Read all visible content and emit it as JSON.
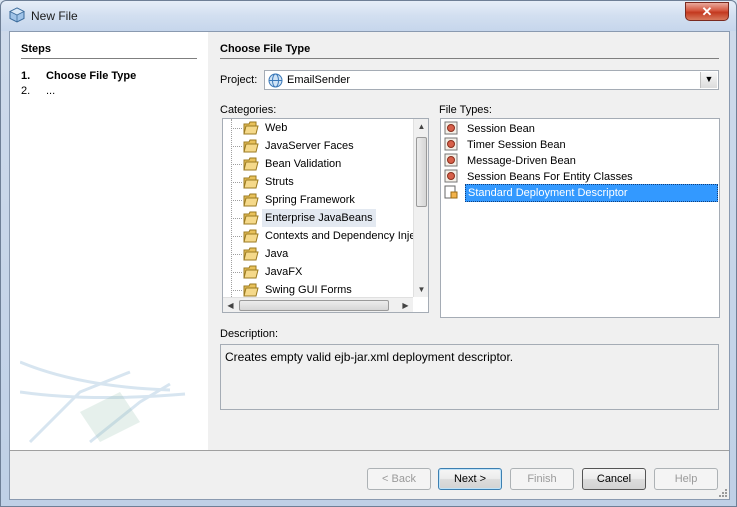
{
  "window": {
    "title": "New File",
    "close_glyph": "✕",
    "title_icon": "netbeans-cube-icon"
  },
  "steps": {
    "heading": "Steps",
    "items": [
      {
        "num": "1.",
        "label": "Choose File Type"
      },
      {
        "num": "2.",
        "label": "..."
      }
    ]
  },
  "main": {
    "heading": "Choose File Type",
    "project_label": "Project:",
    "project_value": "EmailSender",
    "categories_label": "Categories:",
    "categories": [
      "Web",
      "JavaServer Faces",
      "Bean Validation",
      "Struts",
      "Spring Framework",
      "Enterprise JavaBeans",
      "Contexts and Dependency Inje",
      "Java",
      "JavaFX",
      "Swing GUI Forms"
    ],
    "selected_category": "Enterprise JavaBeans",
    "file_types_label": "File Types:",
    "file_types": [
      "Session Bean",
      "Timer Session Bean",
      "Message-Driven Bean",
      "Session Beans For Entity Classes",
      "Standard Deployment Descriptor"
    ],
    "selected_file_type": "Standard Deployment Descriptor",
    "description_label": "Description:",
    "description": "Creates empty valid ejb-jar.xml deployment descriptor."
  },
  "buttons": {
    "back": "< Back",
    "next": "Next >",
    "finish": "Finish",
    "cancel": "Cancel",
    "help": "Help"
  },
  "colors": {
    "selection": "#3399ff",
    "category_highlight": "#e3e9f1",
    "folder": "#e8c15a"
  }
}
